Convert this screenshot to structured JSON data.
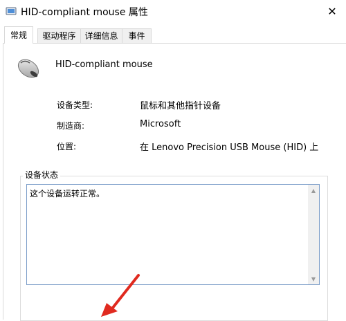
{
  "window": {
    "title": "HID-compliant mouse 属性",
    "close_glyph": "✕"
  },
  "tabs": [
    {
      "label": "常规",
      "active": true
    },
    {
      "label": "驱动程序",
      "active": false
    },
    {
      "label": "详细信息",
      "active": false
    },
    {
      "label": "事件",
      "active": false
    }
  ],
  "device": {
    "name": "HID-compliant mouse",
    "icon": "mouse-icon"
  },
  "properties": [
    {
      "label": "设备类型:",
      "value": "鼠标和其他指针设备"
    },
    {
      "label": "制造商:",
      "value": "Microsoft"
    },
    {
      "label": "位置:",
      "value": "在 Lenovo Precision USB Mouse (HID) 上"
    }
  ],
  "device_status": {
    "group_label": "设备状态",
    "text": "这个设备运转正常。"
  },
  "colors": {
    "annotation_arrow": "#e02a1f",
    "textbox_border": "#7a9cc8"
  }
}
